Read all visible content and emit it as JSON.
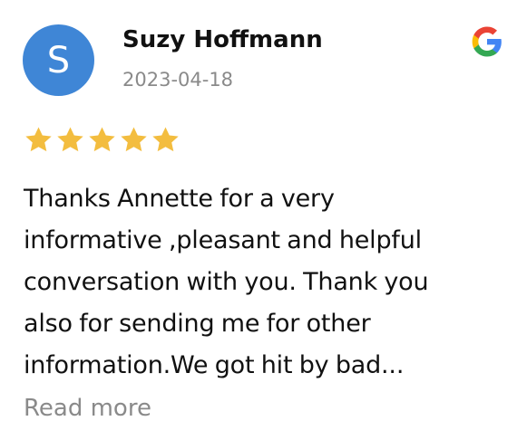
{
  "review": {
    "avatar_initial": "S",
    "reviewer_name": "Suzy Hoffmann",
    "date": "2023-04-18",
    "rating": 5,
    "rating_max": 5,
    "text_lines": [
      "Thanks Annette for a very",
      "informative ,pleasant and helpful",
      "conversation with you. Thank you",
      "also for sending me for other",
      "information.We got hit by bad..."
    ],
    "read_more_label": "Read more",
    "source_icon": "google-icon"
  },
  "colors": {
    "avatar_bg": "#3f86d6",
    "star": "#f3bd3f",
    "secondary_text": "#8a8a8a",
    "primary_text": "#111111"
  }
}
